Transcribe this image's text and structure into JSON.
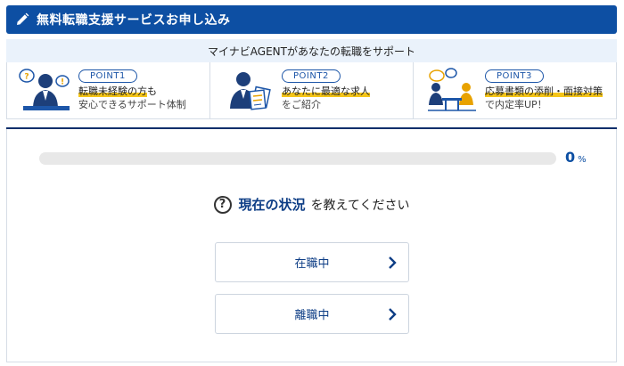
{
  "header": {
    "title": "無料転職支援サービスお申し込み",
    "icon": "pencil-icon"
  },
  "support": {
    "text": "マイナビAGENTがあなたの転職をサポート"
  },
  "points": [
    {
      "badge": "POINT1",
      "highlight": "転職未経験の方",
      "rest": "も",
      "line2": "安心できるサポート体制"
    },
    {
      "badge": "POINT2",
      "highlight": "あなたに最適な求人",
      "rest": "",
      "line2": "をご紹介"
    },
    {
      "badge": "POINT3",
      "highlight": "応募書類の添削・面接対策",
      "rest": "",
      "line2": "で内定率UP！"
    }
  ],
  "progress": {
    "value": 0,
    "number": "0",
    "unit": "%"
  },
  "question": {
    "strong": "現在の状況",
    "rest": "を教えてください"
  },
  "choices": [
    {
      "label": "在職中"
    },
    {
      "label": "離職中"
    }
  ],
  "colors": {
    "brand": "#0d4fa3",
    "accent": "#f5c518",
    "navy": "#0d2f6b"
  }
}
